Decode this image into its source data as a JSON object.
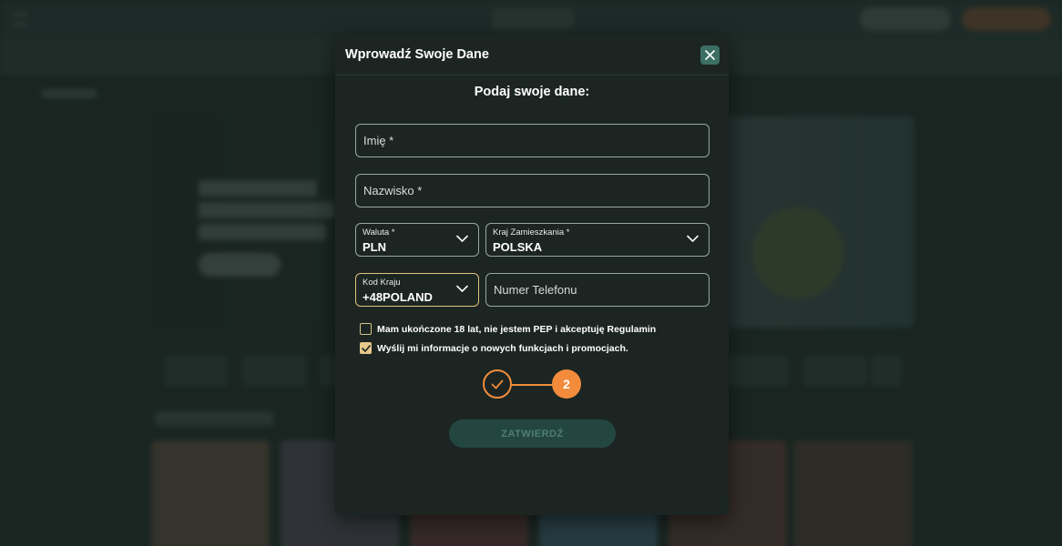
{
  "modal": {
    "title": "Wprowadź Swoje Dane",
    "subtitle": "Podaj swoje dane:",
    "close_icon": "close-icon"
  },
  "form": {
    "first_name": {
      "placeholder": "Imię *",
      "value": ""
    },
    "last_name": {
      "placeholder": "Nazwisko *",
      "value": ""
    },
    "currency": {
      "label": "Waluta *",
      "value": "PLN"
    },
    "country": {
      "label": "Kraj Zamieszkania *",
      "value": "POLSKA"
    },
    "country_code": {
      "label": "Kod Kraju",
      "value": "+48POLAND"
    },
    "phone": {
      "placeholder": "Numer Telefonu",
      "value": ""
    }
  },
  "checkboxes": [
    {
      "label": "Mam ukończone 18 lat, nie jestem PEP i akceptuję Regulamin",
      "checked": false
    },
    {
      "label": "Wyślij mi informacje o nowych funkcjach i promocjach.",
      "checked": true
    }
  ],
  "stepper": {
    "completed_icon": "checkmark-icon",
    "current_step": "2"
  },
  "submit": {
    "label": "ZATWIERDŹ",
    "enabled": false
  },
  "colors": {
    "accent": "#f28c3c",
    "checkbox": "#e6c98a",
    "close_button": "#3c6f63",
    "submit_disabled": "#234740"
  }
}
